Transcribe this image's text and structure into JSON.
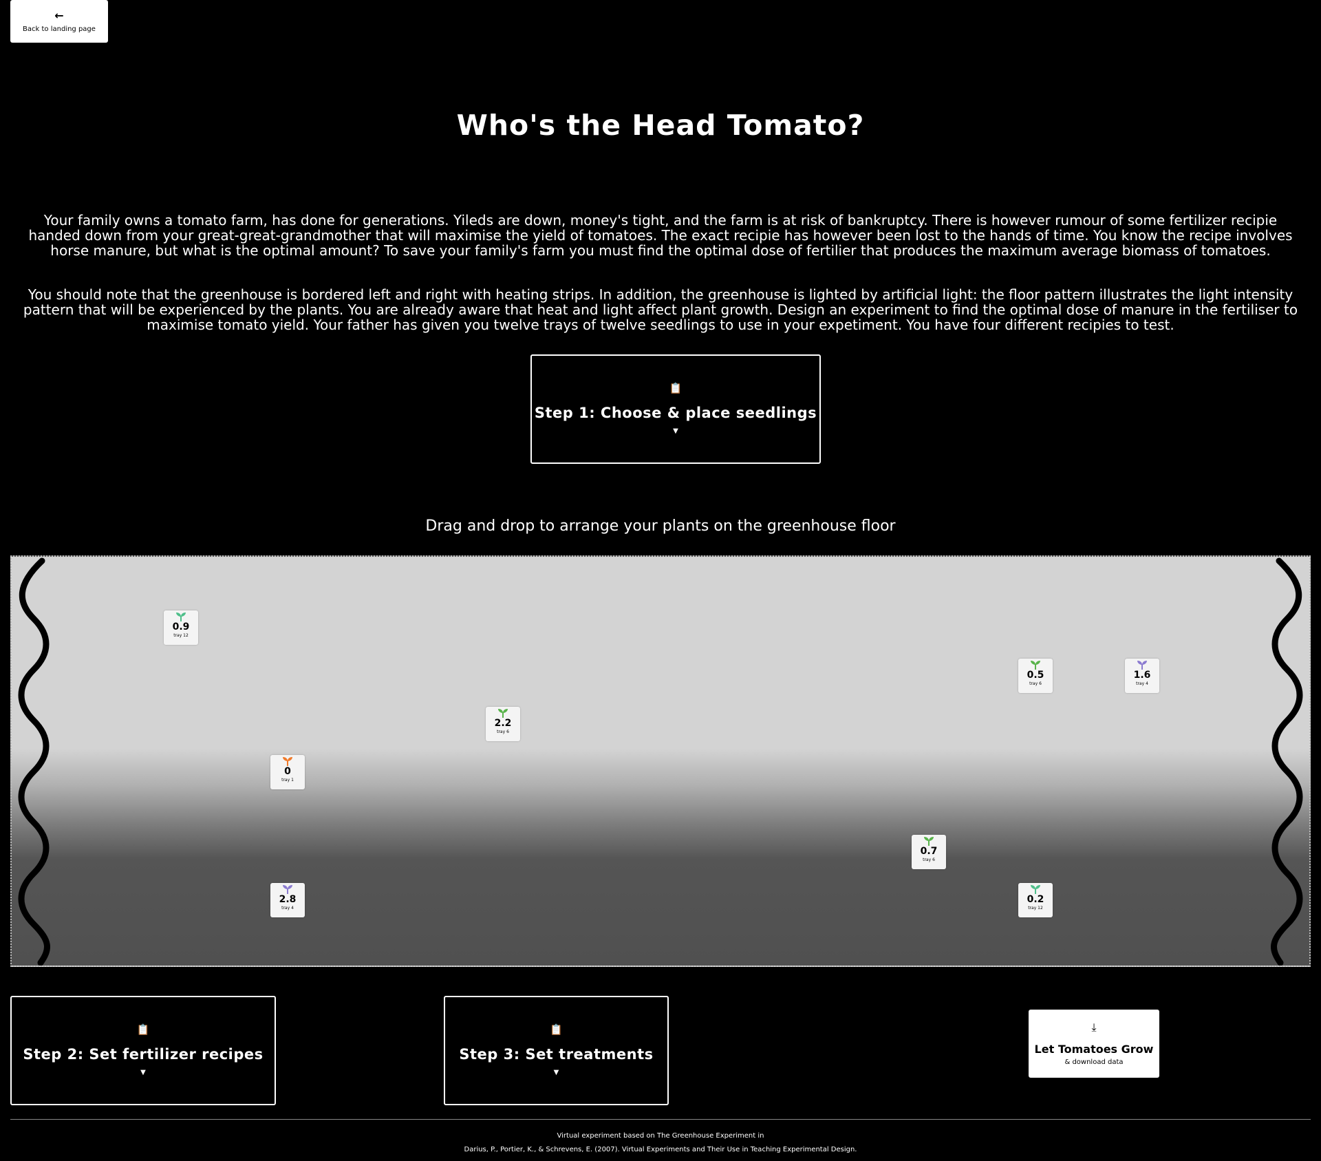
{
  "nav": {
    "back_icon": "arrow-left-icon",
    "back_label": "Back to landing page"
  },
  "title": "Who's the Head Tomato?",
  "intro": {
    "p1": "Your family owns a tomato farm, has done for generations. Yileds are down, money's tight, and the farm is at risk of bankruptcy. There is however rumour of some fertilizer recipie handed down from your great-great-grandmother that will maximise the yield of tomatoes. The exact recipie has however been lost to the hands of time. You know the recipe involves horse manure, but what is the optimal amount? To save your family's farm you must find the optimal dose of fertilier that produces the maximum average biomass of tomatoes.",
    "p2": "You should note that the greenhouse is bordered left and right with heating strips. In addition, the greenhouse is lighted by artificial light: the floor pattern illustrates the light intensity pattern that will be experienced by the plants. You are already aware that heat and light affect plant growth. Design an experiment to find the optimal dose of manure in the fertiliser to maximise tomato yield. Your father has given you twelve trays of twelve seedlings to use in your expetiment. You have four different recipies to test."
  },
  "steps": {
    "step1": "Step 1: Choose & place seedlings",
    "step2": "Step 2: Set fertilizer recipes",
    "step3": "Step 3: Set treatments",
    "icon": "clipboard-icon",
    "caret_icon": "caret-down-icon"
  },
  "drag_hint": "Drag and drop to arrange your plants on the greenhouse floor",
  "greenhouse": {
    "heating_strips": [
      "left",
      "right"
    ],
    "light_pattern": "bright upper half fading to dark lower half",
    "plants": [
      {
        "value": "0.9",
        "tray": "tray 12",
        "sprout_color": "#4fbf8a"
      },
      {
        "value": "0.5",
        "tray": "tray 6",
        "sprout_color": "#58b34a"
      },
      {
        "value": "1.6",
        "tray": "tray 4",
        "sprout_color": "#8b7bd0"
      },
      {
        "value": "2.2",
        "tray": "tray 6",
        "sprout_color": "#58b34a"
      },
      {
        "value": "0",
        "tray": "tray 1",
        "sprout_color": "#f07a2a"
      },
      {
        "value": "0.7",
        "tray": "tray 6",
        "sprout_color": "#58b34a"
      },
      {
        "value": "2.8",
        "tray": "tray 4",
        "sprout_color": "#8b7bd0"
      },
      {
        "value": "0.2",
        "tray": "tray 12",
        "sprout_color": "#4fbf8a"
      }
    ]
  },
  "grow_button": {
    "icon": "download-icon",
    "label": "Let Tomatoes Grow",
    "sub_label": "& download data"
  },
  "footer": {
    "line1": "Virtual experiment based on The Greenhouse Experiment in",
    "line2": "Darius, P., Portier, K., & Schrevens, E. (2007). Virtual Experiments and Their Use in Teaching Experimental Design."
  }
}
